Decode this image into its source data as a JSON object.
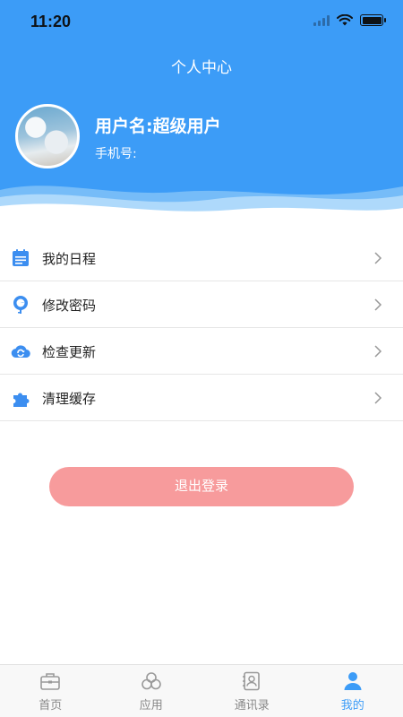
{
  "status_bar": {
    "time": "11:20"
  },
  "header": {
    "title": "个人中心",
    "username": "用户名:超级用户",
    "phone_label": "手机号:"
  },
  "menu": [
    {
      "label": "我的日程",
      "icon": "calendar-icon"
    },
    {
      "label": "修改密码",
      "icon": "key-icon"
    },
    {
      "label": "检查更新",
      "icon": "cloud-refresh-icon"
    },
    {
      "label": "清理缓存",
      "icon": "puzzle-icon"
    }
  ],
  "logout_label": "退出登录",
  "tabs": [
    {
      "label": "首页",
      "icon": "briefcase-icon",
      "active": false
    },
    {
      "label": "应用",
      "icon": "apps-icon",
      "active": false
    },
    {
      "label": "通讯录",
      "icon": "contacts-icon",
      "active": false
    },
    {
      "label": "我的",
      "icon": "person-icon",
      "active": true
    }
  ],
  "colors": {
    "primary": "#3c9cf7",
    "logout": "#f79b9c",
    "tab_inactive": "#888888"
  }
}
